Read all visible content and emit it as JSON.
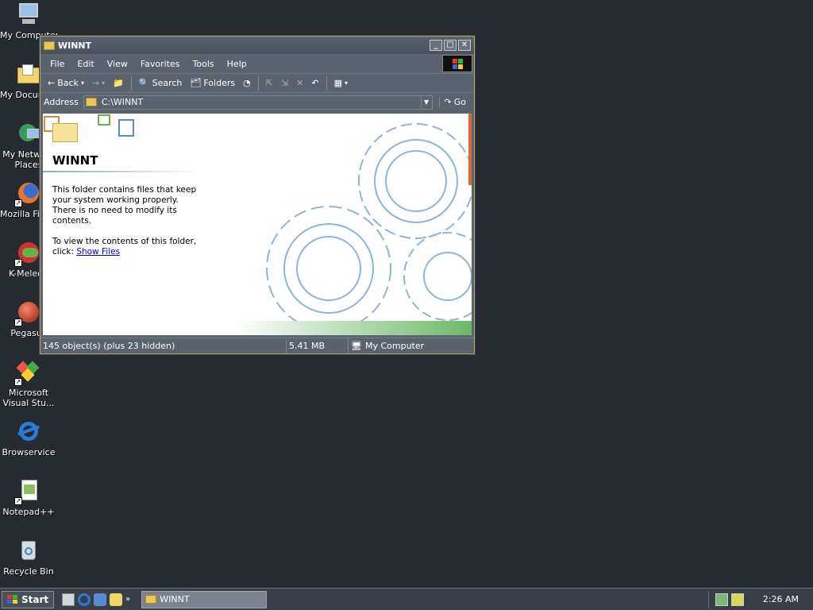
{
  "desktop": {
    "icons": [
      {
        "label": "My Computer",
        "icon": "my-computer-icon"
      },
      {
        "label": "My Documents",
        "icon": "my-documents-icon"
      },
      {
        "label": "My Network Places",
        "icon": "network-places-icon"
      },
      {
        "label": "Mozilla Firefox",
        "icon": "firefox-icon"
      },
      {
        "label": "K-Meleon",
        "icon": "kmeleon-icon"
      },
      {
        "label": "Pegasus",
        "icon": "pegasus-icon"
      },
      {
        "label": "Microsoft Visual Stu...",
        "icon": "visual-studio-icon"
      },
      {
        "label": "Browservice",
        "icon": "ie-icon"
      },
      {
        "label": "Notepad++",
        "icon": "notepad-icon"
      },
      {
        "label": "Recycle Bin",
        "icon": "recycle-bin-icon"
      }
    ]
  },
  "window": {
    "title": "WINNT",
    "menu": [
      "File",
      "Edit",
      "View",
      "Favorites",
      "Tools",
      "Help"
    ],
    "toolbar": {
      "back": "Back",
      "search": "Search",
      "folders": "Folders"
    },
    "address": {
      "label": "Address",
      "value": "C:\\WINNT",
      "go": "Go"
    },
    "content": {
      "folder_title": "WINNT",
      "paragraph1": "This folder contains files that keep your system working properly. There is no need to modify its contents.",
      "paragraph2": "To view the contents of this folder, click:",
      "link": "Show Files"
    },
    "status": {
      "objects": "145 object(s) (plus 23 hidden)",
      "size": "5.41 MB",
      "zone": "My Computer"
    }
  },
  "taskbar": {
    "start": "Start",
    "task": "WINNT",
    "clock": "2:26 AM"
  }
}
